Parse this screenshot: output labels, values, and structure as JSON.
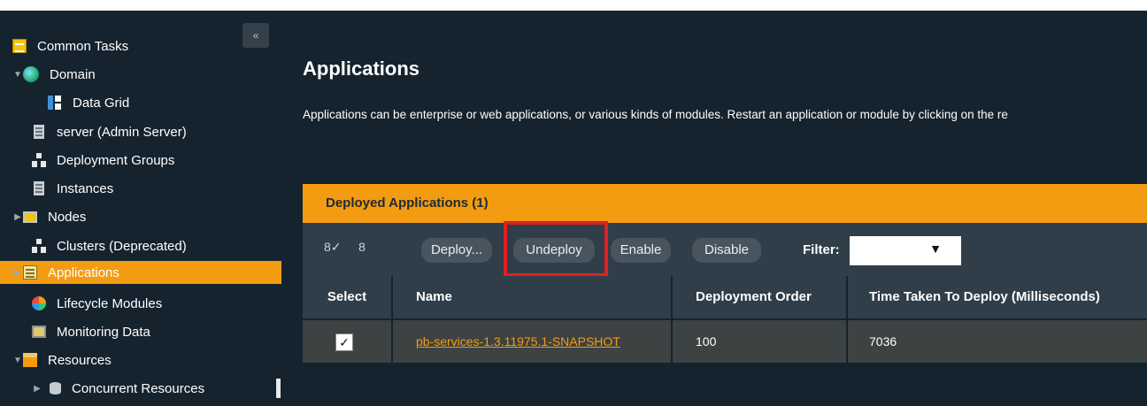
{
  "sidebar": {
    "collapse_glyph": "«",
    "items": [
      {
        "label": "Common Tasks",
        "icon": "tasks-icon"
      },
      {
        "label": "Domain",
        "icon": "globe-icon"
      },
      {
        "label": "Data Grid",
        "icon": "data-grid-icon"
      },
      {
        "label": "server (Admin Server)",
        "icon": "server-icon"
      },
      {
        "label": "Deployment Groups",
        "icon": "group-icon"
      },
      {
        "label": "Instances",
        "icon": "server-icon"
      },
      {
        "label": "Nodes",
        "icon": "node-icon"
      },
      {
        "label": "Clusters (Deprecated)",
        "icon": "group-icon"
      },
      {
        "label": "Applications",
        "icon": "applications-icon"
      },
      {
        "label": "Lifecycle Modules",
        "icon": "lifecycle-icon"
      },
      {
        "label": "Monitoring Data",
        "icon": "monitor-icon"
      },
      {
        "label": "Resources",
        "icon": "resources-icon"
      },
      {
        "label": "Concurrent Resources",
        "icon": "database-icon"
      }
    ]
  },
  "main": {
    "title": "Applications",
    "description": "Applications can be enterprise or web applications, or various kinds of modules. Restart an application or module by clicking on the re",
    "panel_title": "Deployed Applications (1)",
    "toolbar": {
      "select_all_glyph": "8✓",
      "deselect_all_glyph": "8",
      "deploy_label": "Deploy...",
      "undeploy_label": "Undeploy",
      "enable_label": "Enable",
      "disable_label": "Disable",
      "filter_label": "Filter:",
      "filter_arrow": "▼"
    },
    "table": {
      "headers": [
        "Select",
        "Name",
        "Deployment Order",
        "Time Taken To Deploy (Milliseconds)"
      ],
      "rows": [
        {
          "checked_glyph": "✓",
          "name": "pb-services-1.3.11975.1-SNAPSHOT",
          "order": "100",
          "time": "7036"
        }
      ]
    }
  },
  "colors": {
    "background": "#15232e",
    "accent": "#f39c12",
    "toolbar": "#2f3e49",
    "highlight": "#e02020"
  }
}
